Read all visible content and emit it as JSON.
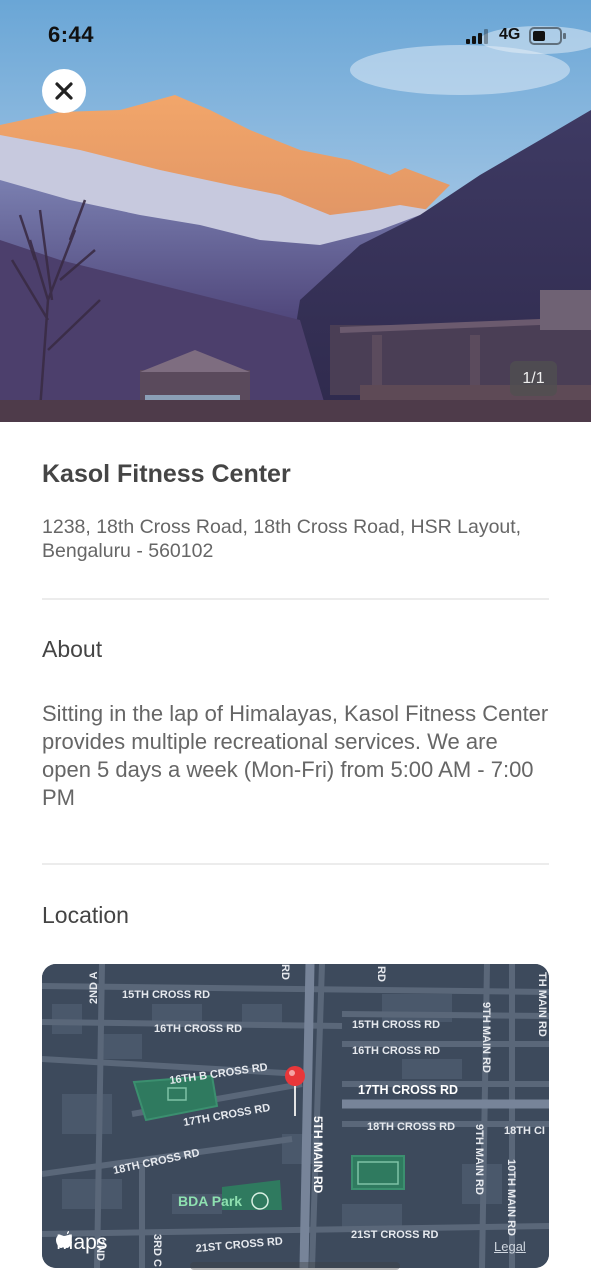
{
  "status_bar": {
    "time": "6:44",
    "network": "4G"
  },
  "gallery": {
    "counter": "1/1"
  },
  "place": {
    "name": "Kasol Fitness Center",
    "address": "1238, 18th Cross Road, 18th Cross Road, HSR Layout, Bengaluru - 560102"
  },
  "about": {
    "heading": "About",
    "text": "Sitting in the lap of Himalayas, Kasol Fitness Center provides multiple recreational services. We are open 5 days a week (Mon-Fri) from 5:00 AM - 7:00 PM"
  },
  "location": {
    "heading": "Location",
    "map_labels": {
      "cross15": "15TH CROSS RD",
      "cross16": "16TH CROSS RD",
      "cross15r": "15TH CROSS RD",
      "cross16r": "16TH CROSS RD",
      "cross16b": "16TH B CROSS RD",
      "cross17": "17TH CROSS RD",
      "cross17l": "17TH CROSS RD",
      "cross18": "18TH CROSS RD",
      "cross18l": "18TH CROSS RD",
      "cross18r": "18TH CI",
      "cross21": "21ST CROSS RD",
      "cross21l": "21ST CROSS RD",
      "main5": "5TH MAIN RD",
      "main9": "9TH MAIN RD",
      "main9b": "9TH MAIN RD",
      "main10": "10TH MAIN RD",
      "main_edge": "TH MAIN RD",
      "second_a": "2ND A",
      "second": "2ND",
      "third": "3RD C",
      "rd_top": "RD",
      "rd_top2": "RD",
      "park": "BDA Park"
    },
    "maps_brand": "Maps",
    "legal": "Legal"
  },
  "colors": {
    "map_bg": "#3d4a5c",
    "road": "#5a6779",
    "park": "#2f7a5f",
    "pin": "#e8373a"
  }
}
